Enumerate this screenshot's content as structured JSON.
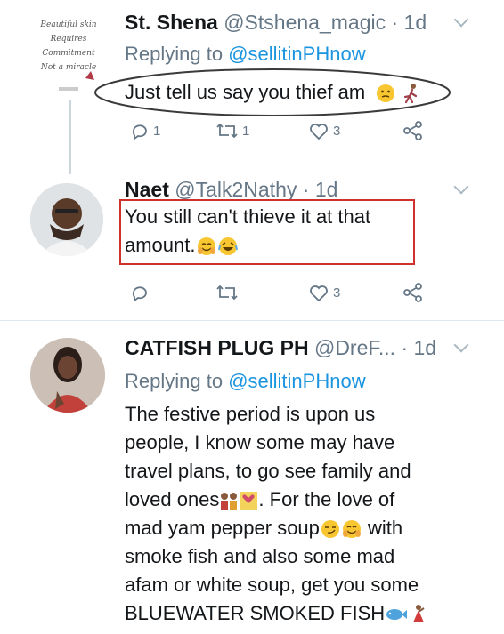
{
  "tweets": [
    {
      "name": "St. Shena",
      "handle": "@Stshena_magic",
      "time": "· 1d",
      "reply_prefix": "Replying to",
      "reply_to": "@sellitinPHnow",
      "text": "Just tell us say you thief am",
      "avatar_caption": "Beautiful skin Requires Commitment Not a miracle",
      "counts": {
        "reply": "1",
        "retweet": "1",
        "like": "3"
      }
    },
    {
      "name": "Naet",
      "handle": "@Talk2Nathy",
      "time": "· 1d",
      "lines": [
        "You still can't thieve it at that",
        "amount."
      ],
      "counts": {
        "reply": "",
        "retweet": "",
        "like": "3"
      }
    },
    {
      "name": "CATFISH PLUG PH",
      "handle": "@DreF...",
      "time": "· 1d",
      "reply_prefix": "Replying to",
      "reply_to": "@sellitinPHnow",
      "lines": [
        "The festive period is upon us",
        "people, I know some may have",
        "travel plans, to go see family and",
        "loved ones",
        ". For the love of",
        "mad yam pepper soup",
        " with",
        "smoke fish and also some mad",
        "afam or white soup, get you some",
        "BLUEWATER SMOKED FISH"
      ]
    }
  ],
  "colors": {
    "link": "#1b95e0",
    "secondary": "#657786",
    "highlight_box": "#d0312d",
    "highlight_ellipse": "#3a3a3a"
  },
  "icons": [
    "reply-icon",
    "retweet-icon",
    "like-icon",
    "share-icon",
    "chevron-down-icon"
  ]
}
